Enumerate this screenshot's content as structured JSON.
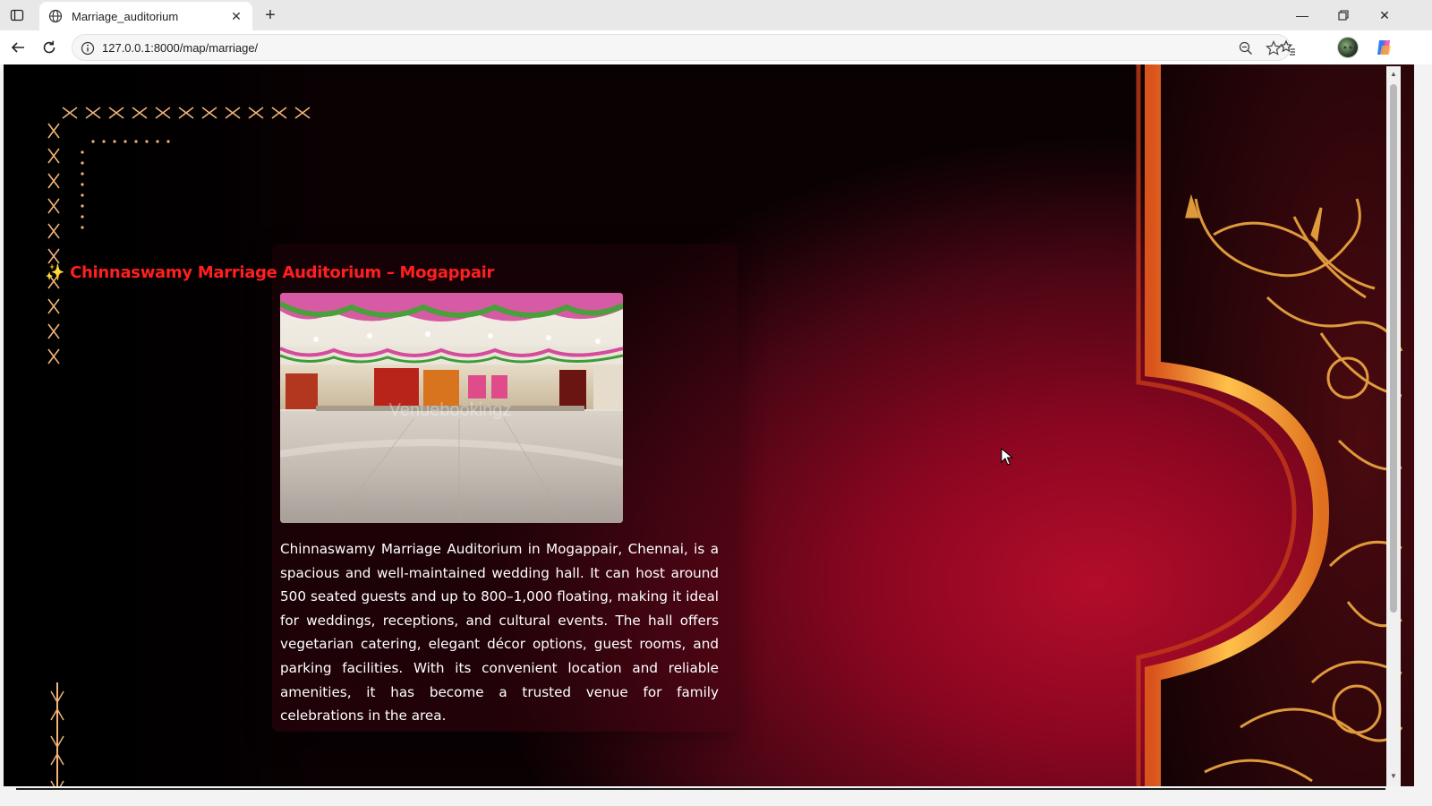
{
  "browser": {
    "tab_title": "Marriage_auditorium",
    "url": "127.0.0.1:8000/map/marriage/",
    "icons": [
      "tab-actions-icon",
      "globe-icon",
      "close-icon",
      "new-tab-icon",
      "minimize-icon",
      "restore-icon",
      "window-close-icon",
      "back-icon",
      "reload-icon",
      "info-icon",
      "zoom-out-icon",
      "favorite-star-icon",
      "favorites-icon",
      "more-icon",
      "copilot-icon"
    ]
  },
  "page": {
    "title_sparkle": "✨",
    "title": "Chinnaswamy Marriage Auditorium – Mogappair",
    "image_watermark": "Venuebookingz",
    "description": "Chinnaswamy Marriage Auditorium in Mogappair, Chennai, is a spacious and well-maintained wedding hall. It can host around 500 seated guests and up to 800–1,000 floating, making it ideal for weddings, receptions, and cultural events. The hall offers vegetarian catering, elegant décor options, guest rooms, and parking facilities. With its convenient location and reliable amenities, it has become a trusted venue for family celebrations in the area.",
    "colors": {
      "title": "#ff1f1f",
      "accent_gold": "#f5a623",
      "bg_red": "#8c0621"
    }
  }
}
